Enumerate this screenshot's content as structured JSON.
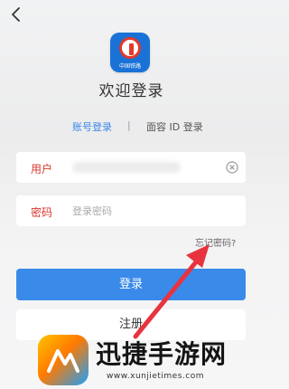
{
  "header": {
    "back_icon": "chevron-left-icon"
  },
  "app": {
    "logo_text": "中国铁路",
    "welcome_title": "欢迎登录",
    "brand_color": "#1a72d6"
  },
  "tabs": {
    "account_label": "账号登录",
    "separator": "|",
    "face_label": "面容 ID 登录",
    "active_color": "#3a86e8"
  },
  "form": {
    "username_label": "用户",
    "username_clear_icon": "clear-circle-icon",
    "password_label": "密码",
    "password_placeholder": "登录密码",
    "forgot_label": "忘记密码?",
    "login_label": "登录",
    "register_label": "注册",
    "label_color": "#d8362b",
    "login_color": "#3a8ae9"
  },
  "watermark": {
    "title": "迅捷手游网",
    "url": "www.xunjietimes.com"
  },
  "annotation": {
    "arrow_color": "#e8333f"
  }
}
